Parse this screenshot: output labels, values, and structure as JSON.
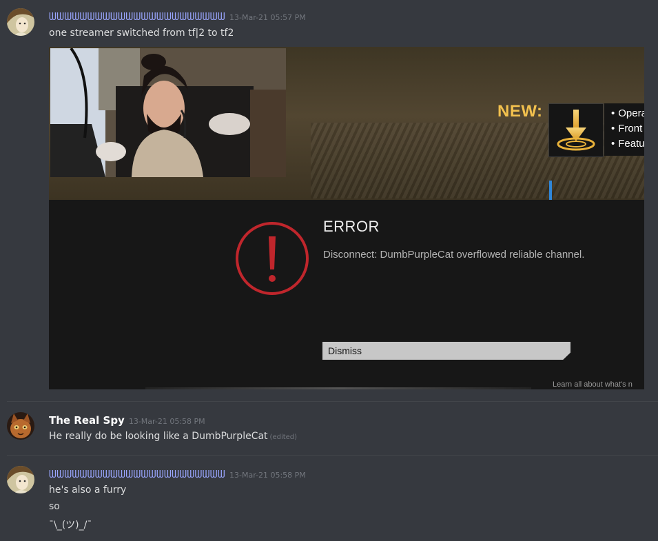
{
  "messages": [
    {
      "author": "ᗯᗯᗯᗯᗯᗯᗯᗯᗯᗯᗯᗯᗯᗯᗯᗯᗯᗯᗯᗯᗯᗯᗯ",
      "timestamp": "13-Mar-21 05:57 PM",
      "lines": [
        "one streamer switched from tf|2 to tf2"
      ],
      "embed": {
        "new_label": "NEW:",
        "new_items": [
          "Opera",
          "Front",
          "Featu"
        ],
        "error_title": "ERROR",
        "error_message": "Disconnect: DumbPurpleCat overflowed reliable channel.",
        "dismiss_label": "Dismiss",
        "footer_text": "Learn all about what's n"
      }
    },
    {
      "author": "The Real Spy",
      "timestamp": "13-Mar-21 05:58 PM",
      "lines": [
        "He really do be looking like a DumbPurpleCat"
      ],
      "edited": "(edited)"
    },
    {
      "author": "ᗯᗯᗯᗯᗯᗯᗯᗯᗯᗯᗯᗯᗯᗯᗯᗯᗯᗯᗯᗯᗯᗯᗯ",
      "timestamp": "13-Mar-21 05:58 PM",
      "lines": [
        "he's also a furry",
        "so",
        "¯\\_(ツ)_/¯"
      ]
    }
  ],
  "colors": {
    "background": "#36393f",
    "username_blue": "#9aa6ff",
    "timestamp": "#72767d",
    "message_text": "#dcddde",
    "new_label": "#f2c14e",
    "error_red": "#c0262c"
  },
  "icons": {
    "error": "exclamation-circle-icon",
    "new_feature": "drop-arrow-icon"
  }
}
